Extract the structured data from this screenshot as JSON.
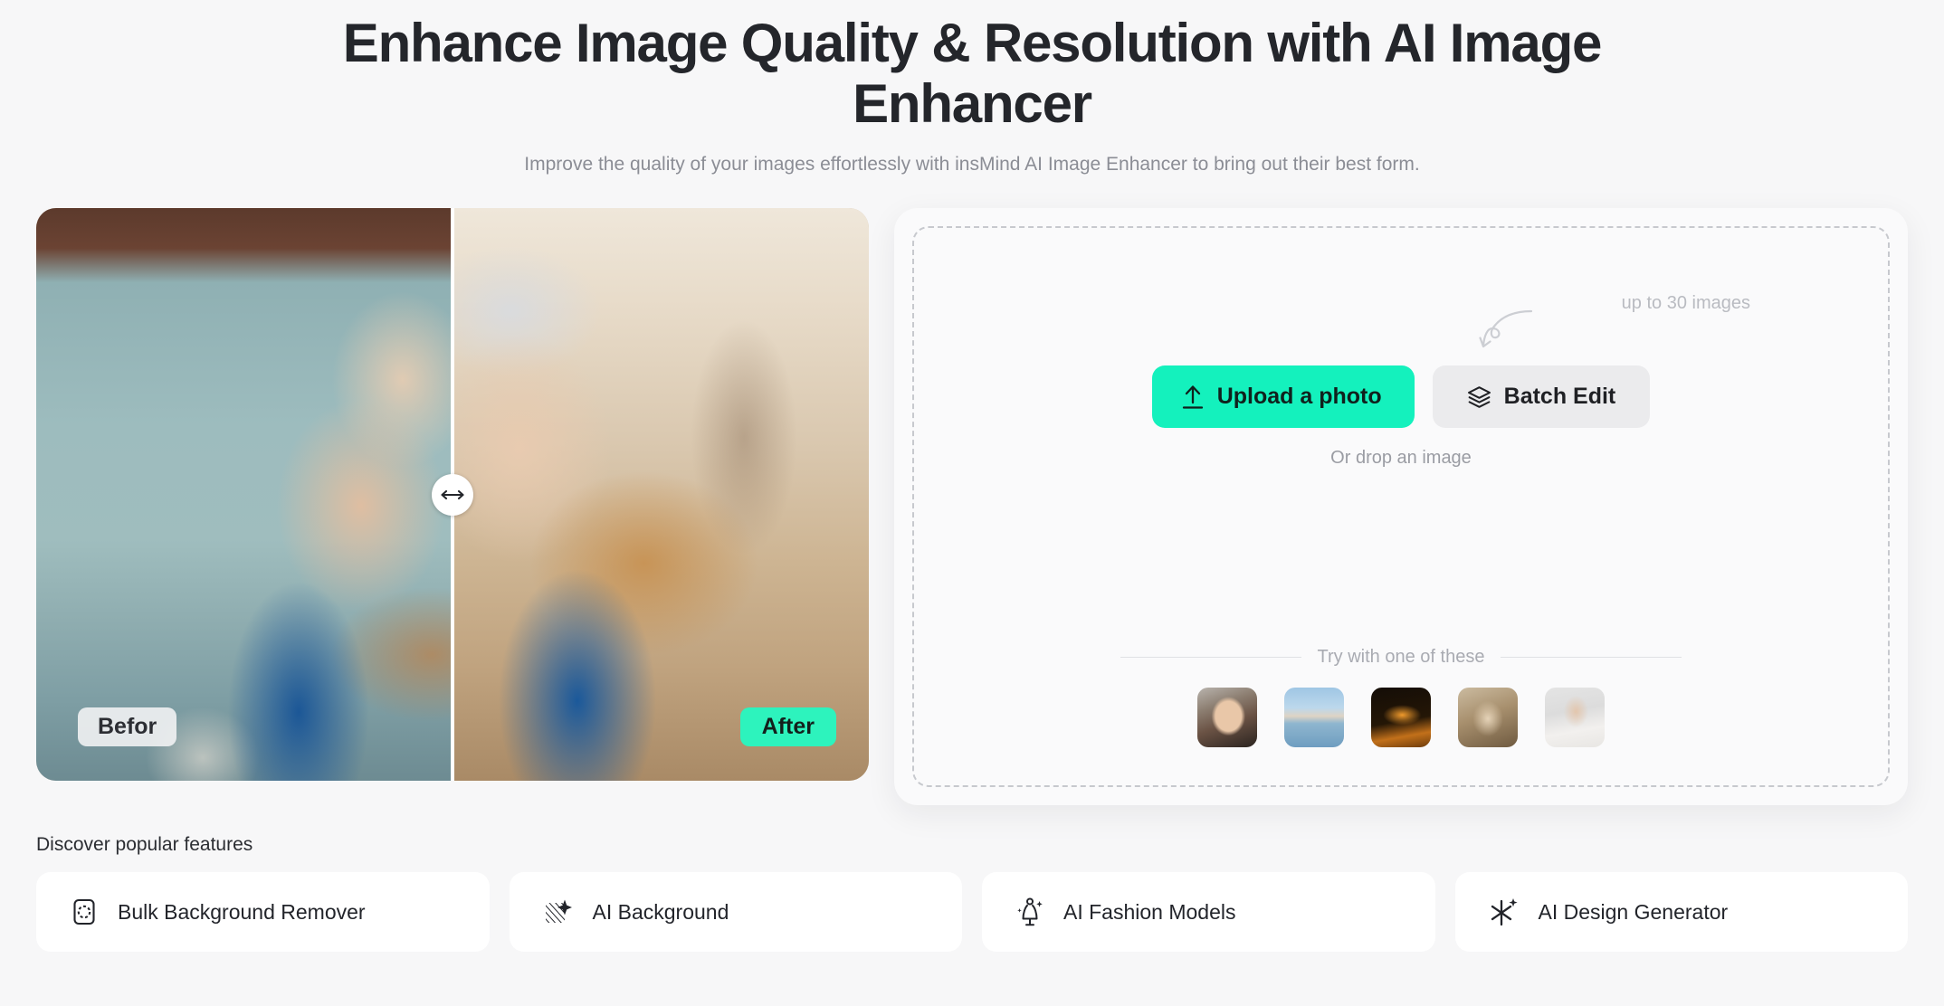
{
  "hero": {
    "title": "Enhance Image Quality & Resolution with AI Image Enhancer",
    "subtitle": "Improve the quality of your images effortlessly with insMind AI Image Enhancer to bring out their best form."
  },
  "comparison": {
    "before_label": "Befor",
    "after_label": "After",
    "handle_icon": "left-right-arrow-icon"
  },
  "upload": {
    "hint_text": "up to 30 images",
    "hint_arrow_icon": "curved-arrow-icon",
    "upload_button": "Upload a photo",
    "upload_icon": "upload-arrow-icon",
    "batch_button": "Batch Edit",
    "batch_icon": "layers-icon",
    "drop_text": "Or drop an image",
    "try_text": "Try with one of these",
    "samples": [
      {
        "name": "sample-portrait-blonde"
      },
      {
        "name": "sample-mountain-lake"
      },
      {
        "name": "sample-orange-sneaker"
      },
      {
        "name": "sample-vintage-portrait"
      },
      {
        "name": "sample-woman-sunglasses"
      }
    ]
  },
  "features": {
    "title": "Discover popular features",
    "items": [
      {
        "label": "Bulk Background Remover",
        "icon": "bulk-background-remover-icon"
      },
      {
        "label": "AI Background",
        "icon": "ai-background-icon"
      },
      {
        "label": "AI Fashion Models",
        "icon": "ai-fashion-models-icon"
      },
      {
        "label": "AI Design Generator",
        "icon": "ai-design-generator-icon"
      }
    ]
  },
  "colors": {
    "accent_green": "#14f1bd",
    "badge_green": "#2df3bd",
    "page_background": "#f7f7f8",
    "batch_button_background": "#ebebed"
  }
}
